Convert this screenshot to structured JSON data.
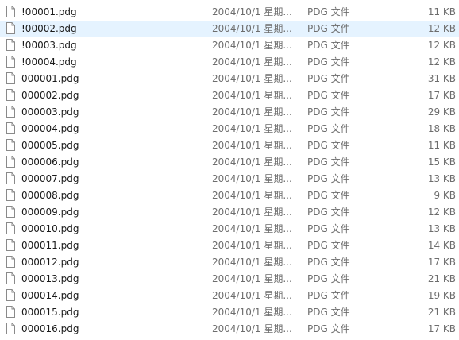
{
  "file_list": {
    "selected_index": 1,
    "rows": [
      {
        "name": "!00001.pdg",
        "date": "2004/10/1 星期...",
        "type": "PDG 文件",
        "size": "11 KB",
        "icon": "document-icon"
      },
      {
        "name": "!00002.pdg",
        "date": "2004/10/1 星期...",
        "type": "PDG 文件",
        "size": "12 KB",
        "icon": "document-icon"
      },
      {
        "name": "!00003.pdg",
        "date": "2004/10/1 星期...",
        "type": "PDG 文件",
        "size": "12 KB",
        "icon": "document-icon"
      },
      {
        "name": "!00004.pdg",
        "date": "2004/10/1 星期...",
        "type": "PDG 文件",
        "size": "12 KB",
        "icon": "document-icon"
      },
      {
        "name": "000001.pdg",
        "date": "2004/10/1 星期...",
        "type": "PDG 文件",
        "size": "31 KB",
        "icon": "document-icon"
      },
      {
        "name": "000002.pdg",
        "date": "2004/10/1 星期...",
        "type": "PDG 文件",
        "size": "17 KB",
        "icon": "document-icon"
      },
      {
        "name": "000003.pdg",
        "date": "2004/10/1 星期...",
        "type": "PDG 文件",
        "size": "29 KB",
        "icon": "document-icon"
      },
      {
        "name": "000004.pdg",
        "date": "2004/10/1 星期...",
        "type": "PDG 文件",
        "size": "18 KB",
        "icon": "document-icon"
      },
      {
        "name": "000005.pdg",
        "date": "2004/10/1 星期...",
        "type": "PDG 文件",
        "size": "11 KB",
        "icon": "document-icon"
      },
      {
        "name": "000006.pdg",
        "date": "2004/10/1 星期...",
        "type": "PDG 文件",
        "size": "15 KB",
        "icon": "document-icon"
      },
      {
        "name": "000007.pdg",
        "date": "2004/10/1 星期...",
        "type": "PDG 文件",
        "size": "13 KB",
        "icon": "document-icon"
      },
      {
        "name": "000008.pdg",
        "date": "2004/10/1 星期...",
        "type": "PDG 文件",
        "size": "9 KB",
        "icon": "document-icon"
      },
      {
        "name": "000009.pdg",
        "date": "2004/10/1 星期...",
        "type": "PDG 文件",
        "size": "12 KB",
        "icon": "document-icon"
      },
      {
        "name": "000010.pdg",
        "date": "2004/10/1 星期...",
        "type": "PDG 文件",
        "size": "13 KB",
        "icon": "document-icon"
      },
      {
        "name": "000011.pdg",
        "date": "2004/10/1 星期...",
        "type": "PDG 文件",
        "size": "14 KB",
        "icon": "document-icon"
      },
      {
        "name": "000012.pdg",
        "date": "2004/10/1 星期...",
        "type": "PDG 文件",
        "size": "17 KB",
        "icon": "document-icon"
      },
      {
        "name": "000013.pdg",
        "date": "2004/10/1 星期...",
        "type": "PDG 文件",
        "size": "21 KB",
        "icon": "document-icon"
      },
      {
        "name": "000014.pdg",
        "date": "2004/10/1 星期...",
        "type": "PDG 文件",
        "size": "19 KB",
        "icon": "document-icon"
      },
      {
        "name": "000015.pdg",
        "date": "2004/10/1 星期...",
        "type": "PDG 文件",
        "size": "21 KB",
        "icon": "document-icon"
      },
      {
        "name": "000016.pdg",
        "date": "2004/10/1 星期...",
        "type": "PDG 文件",
        "size": "17 KB",
        "icon": "document-icon"
      }
    ]
  },
  "colors": {
    "selection_bg": "#e5f3ff",
    "primary_text": "#1a1a1a",
    "secondary_text": "#6d6d6d"
  }
}
